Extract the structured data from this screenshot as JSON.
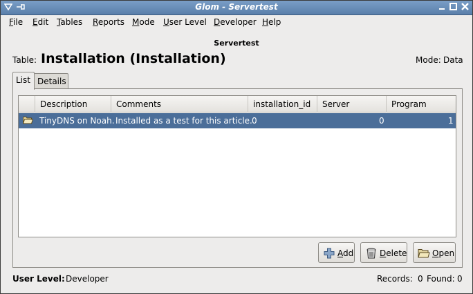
{
  "window": {
    "title": "Glom - Servertest"
  },
  "menubar": {
    "items": [
      {
        "label_m": "F",
        "label_r": "ile"
      },
      {
        "label_m": "E",
        "label_r": "dit"
      },
      {
        "label_m": "T",
        "label_r": "ables"
      },
      {
        "label_m": "R",
        "label_r": "eports"
      },
      {
        "label_m": "M",
        "label_r": "ode"
      },
      {
        "label_m": "U",
        "label_r": "ser Level"
      },
      {
        "label_m": "D",
        "label_r": "eveloper"
      },
      {
        "label_m": "H",
        "label_r": "elp"
      }
    ]
  },
  "header": {
    "database": "Servertest",
    "table_label": "Table:",
    "table_name": "Installation (Installation)",
    "mode_label": "Mode:",
    "mode_value": "Data"
  },
  "tabs": [
    {
      "label": "List"
    },
    {
      "label": "Details"
    }
  ],
  "list": {
    "columns": [
      "Description",
      "Comments",
      "installation_id",
      "Server",
      "Program"
    ],
    "rows": [
      {
        "description": "TinyDNS on Noah.",
        "comments": "Installed as a test for this article.",
        "installation_id": "0",
        "server": "0",
        "program": "1"
      }
    ]
  },
  "buttons": {
    "add_m": "A",
    "add_r": "dd",
    "delete_m": "D",
    "delete_r": "elete",
    "open_m": "O",
    "open_r": "pen"
  },
  "status": {
    "user_level_label": "User Level:",
    "user_level_value": "Developer",
    "records_label": "Records:",
    "records_value": "0",
    "found_label": "Found:",
    "found_value": "0"
  },
  "colors": {
    "titlebar": "#5a7faa",
    "selection": "#4b6e99",
    "window_bg": "#edeceb"
  }
}
